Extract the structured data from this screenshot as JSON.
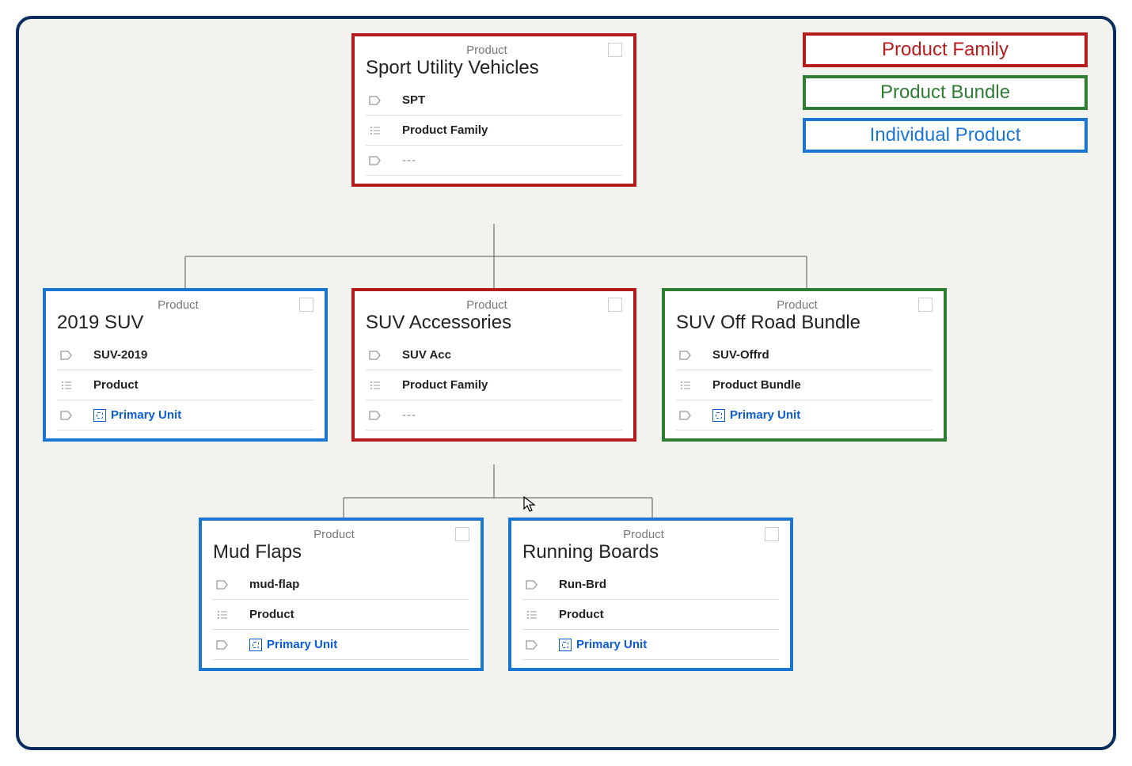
{
  "legend": {
    "family": "Product Family",
    "bundle": "Product Bundle",
    "product": "Individual Product"
  },
  "cards": {
    "root": {
      "type_label": "Product",
      "title": "Sport Utility Vehicles",
      "code": "SPT",
      "structure": "Product Family",
      "unit": "---"
    },
    "suv2019": {
      "type_label": "Product",
      "title": "2019 SUV",
      "code": "SUV-2019",
      "structure": "Product",
      "unit": "Primary Unit"
    },
    "accessories": {
      "type_label": "Product",
      "title": "SUV Accessories",
      "code": "SUV Acc",
      "structure": "Product Family",
      "unit": "---"
    },
    "offroad": {
      "type_label": "Product",
      "title": "SUV Off Road Bundle",
      "code": "SUV-Offrd",
      "structure": "Product Bundle",
      "unit": "Primary Unit"
    },
    "mudflaps": {
      "type_label": "Product",
      "title": "Mud Flaps",
      "code": "mud-flap",
      "structure": "Product",
      "unit": "Primary Unit"
    },
    "runningboards": {
      "type_label": "Product",
      "title": "Running Boards",
      "code": "Run-Brd",
      "structure": "Product",
      "unit": "Primary Unit"
    }
  }
}
